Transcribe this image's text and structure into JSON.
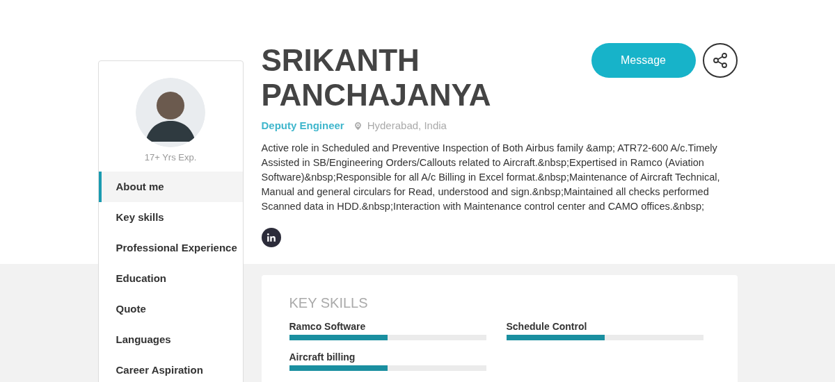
{
  "profile": {
    "experience": "17+ Yrs Exp.",
    "name": "SRIKANTH PANCHAJANYA",
    "title": "Deputy Engineer",
    "location": "Hyderabad, India",
    "summary": "Active role in Scheduled and Preventive Inspection of Both Airbus family &amp; ATR72-600 A/c.Timely Assisted in SB/Engineering Orders/Callouts related to Aircraft.&nbsp;Expertised in Ramco (Aviation Software)&nbsp;Responsible for all A/c Billing in Excel format.&nbsp;Maintenance of Aircraft Technical, Manual and general circulars for Read, understood and sign.&nbsp;Maintained all checks performed Scanned data in HDD.&nbsp;Interaction with Maintenance control center and CAMO offices.&nbsp;"
  },
  "actions": {
    "message_button": "Message"
  },
  "sidebar": {
    "items": [
      {
        "label": "About me",
        "selected": true
      },
      {
        "label": "Key skills",
        "selected": false
      },
      {
        "label": "Professional Experience",
        "selected": false
      },
      {
        "label": "Education",
        "selected": false
      },
      {
        "label": "Quote",
        "selected": false
      },
      {
        "label": "Languages",
        "selected": false
      },
      {
        "label": "Career Aspiration",
        "selected": false
      }
    ]
  },
  "key_skills": {
    "heading": "KEY SKILLS",
    "skills": [
      {
        "name": "Ramco Software",
        "level": 0.5
      },
      {
        "name": "Schedule Control",
        "level": 0.5
      },
      {
        "name": "Aircraft billing",
        "level": 0.5
      }
    ]
  }
}
